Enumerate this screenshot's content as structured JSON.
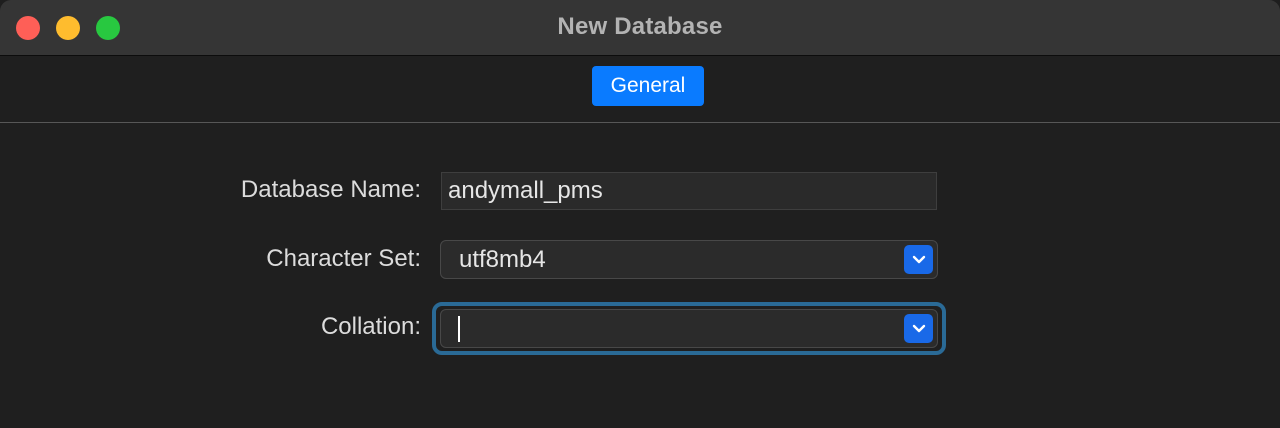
{
  "window": {
    "title": "New Database",
    "controls": [
      "close",
      "minimize",
      "zoom"
    ]
  },
  "tabs": [
    {
      "label": "General",
      "selected": true
    }
  ],
  "form": {
    "database_name": {
      "label": "Database Name:",
      "value": "andymall_pms"
    },
    "character_set": {
      "label": "Character Set:",
      "value": "utf8mb4"
    },
    "collation": {
      "label": "Collation:",
      "value": "",
      "focused": true
    }
  },
  "colors": {
    "accent": "#0a7bff",
    "popup_button": "#1969e8",
    "focus_ring": "#2a6a96",
    "close": "#fe5f57",
    "minimize": "#febc2e",
    "zoom": "#28c840"
  },
  "icons": {
    "popup_arrow": "chevron-up-down-icon"
  }
}
